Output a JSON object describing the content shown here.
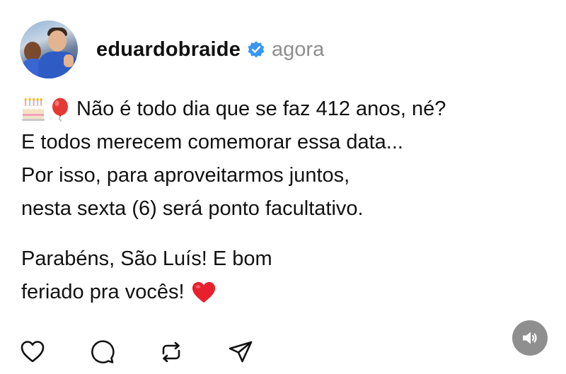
{
  "post": {
    "author": {
      "username": "eduardobraide",
      "avatar_icon": "profile-photo",
      "verified_icon": "verified-badge-icon",
      "verified_color": "#3897f0"
    },
    "timestamp": "agora",
    "caption": {
      "line1": "Não é todo dia que se faz 412 anos, né?",
      "line2": "E todos merecem comemorar essa data...",
      "line3": "Por isso, para aproveitarmos juntos,",
      "line4": "nesta sexta (6) será ponto facultativo.",
      "line5": "Parabéns, São Luís! E bom",
      "line6": "feriado pra vocês!",
      "emojis": [
        "birthday-cake-icon",
        "balloon-icon",
        "red-heart-icon"
      ]
    }
  },
  "actions": {
    "icons": [
      "like-heart-icon",
      "comment-bubble-icon",
      "repost-icon",
      "share-send-icon"
    ]
  },
  "media_control": {
    "icon": "speaker-muted-icon",
    "background": "#8f8f8f"
  }
}
